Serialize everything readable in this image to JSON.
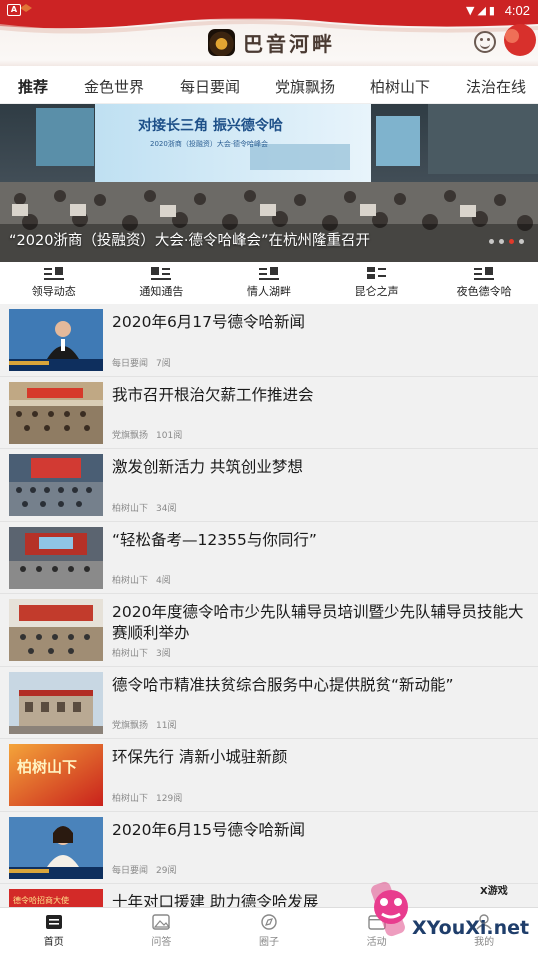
{
  "status_bar": {
    "notification": "A",
    "time": "4:02"
  },
  "header": {
    "app_name": "巴音河畔"
  },
  "tabs": [
    {
      "label": "推荐",
      "active": true
    },
    {
      "label": "金色世界"
    },
    {
      "label": "每日要闻"
    },
    {
      "label": "党旗飘扬"
    },
    {
      "label": "柏树山下"
    },
    {
      "label": "法治在线"
    }
  ],
  "banner": {
    "caption": "“2020浙商（投融资）大会·德令哈峰会”在杭州隆重召开",
    "screen_text": "对接长三角  振兴德令哈",
    "screen_subtext": "2020浙商（投融资）大会·德令哈峰会",
    "slides": 4,
    "current_slide": 3
  },
  "quick_links": [
    {
      "label": "领导动态",
      "icon": "list-grid-icon"
    },
    {
      "label": "通知通告",
      "icon": "list-grid-icon"
    },
    {
      "label": "情人湖畔",
      "icon": "list-grid-icon"
    },
    {
      "label": "昆仑之声",
      "icon": "list-grid-icon"
    },
    {
      "label": "夜色德令哈",
      "icon": "list-grid-icon"
    }
  ],
  "news": [
    {
      "title": "2020年6月17号德令哈新闻",
      "category": "每日要闻",
      "views": "7阅",
      "thumb": "anchor-male"
    },
    {
      "title": "我市召开根治欠薪工作推进会",
      "category": "党旗飘扬",
      "views": "101阅",
      "thumb": "meeting"
    },
    {
      "title": "激发创新活力 共筑创业梦想",
      "category": "柏树山下",
      "views": "34阅",
      "thumb": "hall"
    },
    {
      "title": "“轻松备考—12355与你同行”",
      "category": "柏树山下",
      "views": "4阅",
      "thumb": "classroom"
    },
    {
      "title": "2020年度德令哈市少先队辅导员培训暨少先队辅导员技能大赛顺利举办",
      "category": "柏树山下",
      "views": "3阅",
      "thumb": "stage"
    },
    {
      "title": "德令哈市精准扶贫综合服务中心提供脱贫“新动能”",
      "category": "党旗飘扬",
      "views": "11阅",
      "thumb": "building"
    },
    {
      "title": "环保先行 清新小城驻新颜",
      "category": "柏树山下",
      "views": "129阅",
      "thumb": "red-title"
    },
    {
      "title": "2020年6月15号德令哈新闻",
      "category": "每日要闻",
      "views": "29阅",
      "thumb": "anchor-female"
    },
    {
      "title": "十年对口援建 助力德令哈发展",
      "category": "",
      "views": "",
      "thumb": "red-banner"
    }
  ],
  "thumb_texts": {
    "red-title": "柏树山下",
    "red-banner": "德令哈招商大使"
  },
  "bottom_nav": [
    {
      "label": "首页",
      "icon": "home-list-icon",
      "active": true
    },
    {
      "label": "问答",
      "icon": "picture-icon"
    },
    {
      "label": "圈子",
      "icon": "compass-icon"
    },
    {
      "label": "活动",
      "icon": "calendar-icon"
    },
    {
      "label": "我的",
      "icon": "user-icon"
    }
  ],
  "watermark": {
    "small": "X游戏",
    "big": "XYouXi.net"
  },
  "colors": {
    "brand_red": "#d32a28",
    "accent": "#e23a2a"
  }
}
